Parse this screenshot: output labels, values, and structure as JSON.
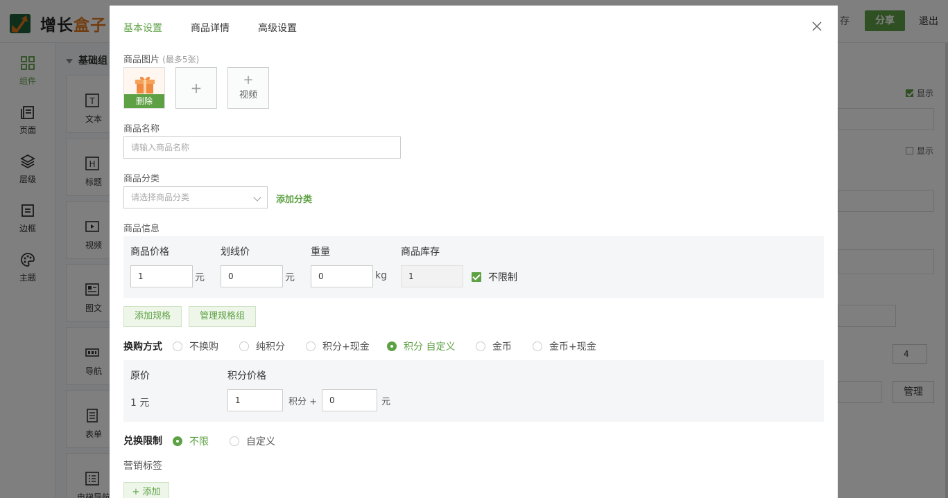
{
  "app": {
    "logo_text_a": "增长",
    "logo_text_b": "盒子",
    "save_label": "存",
    "share_label": "分享",
    "exit_label": "退出"
  },
  "sidebar": {
    "items": [
      {
        "label": "组件",
        "icon": "grid-icon"
      },
      {
        "label": "页面",
        "icon": "pages-icon"
      },
      {
        "label": "层级",
        "icon": "layers-icon"
      },
      {
        "label": "边框",
        "icon": "border-icon"
      },
      {
        "label": "主题",
        "icon": "palette-icon"
      }
    ]
  },
  "panel": {
    "group_title": "基础组",
    "components": [
      {
        "label": "文本",
        "icon": "text-icon"
      },
      {
        "label": "标题",
        "icon": "heading-icon"
      },
      {
        "label": "视频",
        "icon": "video-icon"
      },
      {
        "label": "图文",
        "icon": "image-text-icon"
      },
      {
        "label": "导航",
        "icon": "nav-icon"
      },
      {
        "label": "表单",
        "icon": "form-icon"
      },
      {
        "label": "电梯导航",
        "icon": "elevator-nav-icon"
      }
    ]
  },
  "right_config": {
    "show_label_1": "显示",
    "show_label_2": "显示",
    "count_value": "4",
    "manage_label": "管理"
  },
  "modal": {
    "tabs": [
      "基本设置",
      "商品详情",
      "高级设置"
    ],
    "images_label": "商品图片",
    "images_hint": "(最多5张)",
    "delete_label": "删除",
    "add_image_glyph": "+",
    "add_video_glyph": "+",
    "video_label": "视频",
    "name_label": "商品名称",
    "name_placeholder": "请输入商品名称",
    "category_label": "商品分类",
    "category_placeholder": "请选择商品分类",
    "add_category_link": "添加分类",
    "info_label": "商品信息",
    "info_cols": {
      "price": "商品价格",
      "strike_price": "划线价",
      "weight": "重量",
      "stock": "商品库存"
    },
    "info_values": {
      "price": "1",
      "strike_price": "0",
      "weight": "0",
      "stock": "1"
    },
    "units": {
      "yuan": "元",
      "kg": "kg"
    },
    "unlimited_label": "不限制",
    "add_spec_button": "添加规格",
    "manage_spec_button": "管理规格组",
    "exchange_label": "换购方式",
    "exchange_options": [
      "不换购",
      "纯积分",
      "积分+现金",
      "积分 自定义",
      "金币",
      "金币+现金"
    ],
    "exchange_selected": 3,
    "original_price_label": "原价",
    "points_price_label": "积分价格",
    "original_price_value": "1 元",
    "points_value": "1",
    "points_plus_label": "积分 +",
    "cash_value": "0",
    "cash_unit": "元",
    "limit_label": "兑换限制",
    "limit_options": [
      "不限",
      "自定义"
    ],
    "limit_selected": 0,
    "marketing_label": "营销标签",
    "add_tag_button": "+ 添加"
  }
}
